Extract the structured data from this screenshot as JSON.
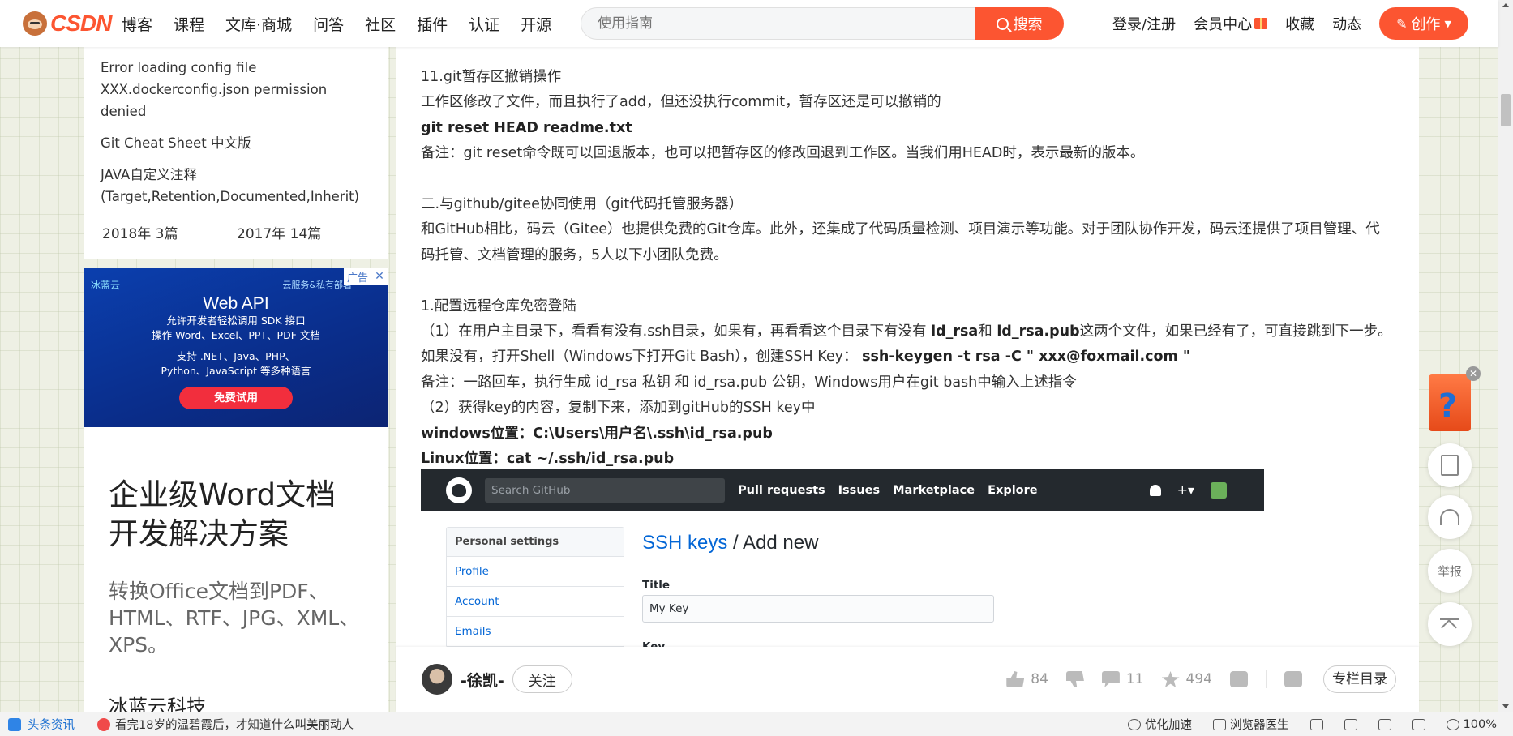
{
  "header": {
    "logo": "CSDN",
    "nav": [
      "博客",
      "课程",
      "文库·商城",
      "问答",
      "社区",
      "插件",
      "认证",
      "开源"
    ],
    "search_placeholder": "使用指南",
    "search_button": "搜索",
    "right": {
      "login": "登录/注册",
      "vip": "会员中心",
      "favorites": "收藏",
      "activity": "动态",
      "create": "创作"
    }
  },
  "sidebar": {
    "links": [
      "Error loading config file XXX.dockerconfig.json permission denied",
      "Git Cheat Sheet 中文版",
      "JAVA自定义注释(Target,Retention,Documented,Inherit)"
    ],
    "archive": [
      "2018年  3篇",
      "2017年  14篇"
    ],
    "ad": {
      "brand": "冰蓝云",
      "brand_right": "云服务&私有部署",
      "tag": "广告",
      "close": "✕",
      "title": "Web API",
      "lines": [
        "允许开发者轻松调用 SDK 接口",
        "操作 Word、Excel、PPT、PDF 文档"
      ],
      "lines2": [
        "支持 .NET、Java、PHP、",
        "Python、JavaScript 等多种语言"
      ],
      "button": "免费试用"
    },
    "promo": {
      "title1": "企业级Word文档",
      "title2": "开发解决方案",
      "sub": "转换Office文档到PDF、HTML、RTF、JPG、XML、XPS。",
      "tail": "冰蓝云科技"
    }
  },
  "article": {
    "s11_title": "11.git暂存区撤销操作",
    "s11_desc": "工作区修改了文件，而且执行了add，但还没执行commit，暂存区还是可以撤销的",
    "s11_cmd": "git reset HEAD readme.txt",
    "s11_note": "备注：git reset命令既可以回退版本，也可以把暂存区的修改回退到工作区。当我们用HEAD时，表示最新的版本。",
    "s2_title": "二.与github/gitee协同使用（git代码托管服务器）",
    "s2_desc": "和GitHub相比，码云（Gitee）也提供免费的Git仓库。此外，还集成了代码质量检测、项目演示等功能。对于团队协作开发，码云还提供了项目管理、代码托管、文档管理的服务，5人以下小团队免费。",
    "s21_title": "1.配置远程仓库免密登陆",
    "s21_step1_a": "（1）在用户主目录下，看看有没有.ssh目录，如果有，再看看这个目录下有没有 ",
    "s21_step1_b": "id_rsa",
    "s21_step1_c": "和 ",
    "s21_step1_d": "id_rsa.pub",
    "s21_step1_e": "这两个文件，如果已经有了，可直接跳到下一步。如果没有，打开Shell（Windows下打开Git Bash），创建SSH Key：",
    "s21_step1_cmd": "ssh-keygen -t rsa -C \" xxx@foxmail.com \"",
    "s21_note": "备注：一路回车，执行生成 id_rsa 私钥 和 id_rsa.pub 公钥，Windows用户在git bash中输入上述指令",
    "s21_step2": "（2）获得key的内容，复制下来，添加到gitHub的SSH key中",
    "s21_win": "windows位置：C:\\Users\\用户名\\.ssh\\id_rsa.pub",
    "s21_linux": "Linux位置：cat ~/.ssh/id_rsa.pub",
    "github": {
      "search": "Search GitHub",
      "nav": [
        "Pull requests",
        "Issues",
        "Marketplace",
        "Explore"
      ],
      "plus": "+▾",
      "menu_head": "Personal settings",
      "menu": [
        "Profile",
        "Account",
        "Emails"
      ],
      "heading_link": "SSH keys",
      "heading_rest": " / Add new",
      "title_label": "Title",
      "title_value": "My Key",
      "key_label": "Key"
    }
  },
  "author_bar": {
    "name": "-徐凯-",
    "follow": "关注",
    "likes": "84",
    "comments": "11",
    "favorites": "494",
    "toc": "专栏目录"
  },
  "floating": {
    "close": "✕",
    "report": "举报"
  },
  "statusbar": {
    "news": "头条资讯",
    "headline": "看完18岁的温碧霞后，才知道什么叫美丽动人",
    "accel": "优化加速",
    "doctor": "浏览器医生",
    "zoom": "100%"
  }
}
